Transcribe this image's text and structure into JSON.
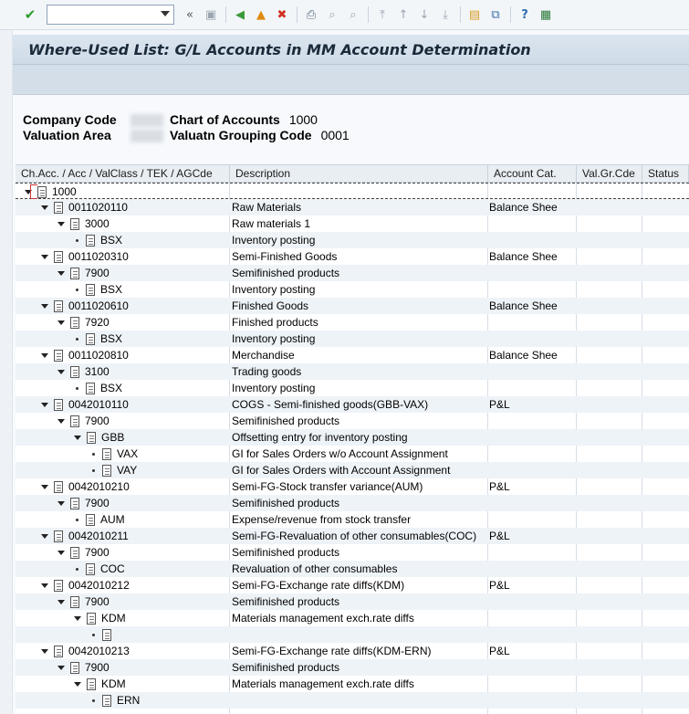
{
  "toolbar": {
    "icons": [
      "check-icon",
      "command-field",
      "back-arrows-icon",
      "save-icon",
      "back-icon",
      "exit-icon",
      "cancel-icon",
      "print-icon",
      "find-icon",
      "find-next-icon",
      "first-page-icon",
      "prev-page-icon",
      "next-page-icon",
      "last-page-icon",
      "create-session-icon",
      "shortcut-icon",
      "help-icon",
      "customize-icon"
    ]
  },
  "title": "Where-Used List: G/L Accounts in MM Account Determination",
  "header": {
    "company_code_label": "Company Code",
    "valuation_area_label": "Valuation Area",
    "chart_of_accounts_label": "Chart of Accounts",
    "chart_of_accounts_value": "1000",
    "valuation_grouping_label": "Valuatn Grouping Code",
    "valuation_grouping_value": "0001"
  },
  "columns": [
    "Ch.Acc. / Acc / ValClass / TEK  / AGCde",
    "Description",
    "Account Cat.",
    "Val.Gr.Cde",
    "Status"
  ],
  "rows": [
    {
      "level": 0,
      "node": "1000",
      "desc": "",
      "cat": "",
      "expanded": true
    },
    {
      "level": 1,
      "node": "0011020110",
      "desc": "Raw Materials",
      "cat": "Balance Shee",
      "expanded": true
    },
    {
      "level": 2,
      "node": "3000",
      "desc": "Raw materials 1",
      "cat": "",
      "expanded": true
    },
    {
      "level": 3,
      "node": "BSX",
      "desc": "Inventory posting",
      "cat": "",
      "leaf": true
    },
    {
      "level": 1,
      "node": "0011020310",
      "desc": "Semi-Finished Goods",
      "cat": "Balance Shee",
      "expanded": true
    },
    {
      "level": 2,
      "node": "7900",
      "desc": "Semifinished products",
      "cat": "",
      "expanded": true
    },
    {
      "level": 3,
      "node": "BSX",
      "desc": "Inventory posting",
      "cat": "",
      "leaf": true
    },
    {
      "level": 1,
      "node": "0011020610",
      "desc": "Finished Goods",
      "cat": "Balance Shee",
      "expanded": true
    },
    {
      "level": 2,
      "node": "7920",
      "desc": "Finished products",
      "cat": "",
      "expanded": true
    },
    {
      "level": 3,
      "node": "BSX",
      "desc": "Inventory posting",
      "cat": "",
      "leaf": true
    },
    {
      "level": 1,
      "node": "0011020810",
      "desc": "Merchandise",
      "cat": "Balance Shee",
      "expanded": true
    },
    {
      "level": 2,
      "node": "3100",
      "desc": "Trading goods",
      "cat": "",
      "expanded": true
    },
    {
      "level": 3,
      "node": "BSX",
      "desc": "Inventory posting",
      "cat": "",
      "leaf": true
    },
    {
      "level": 1,
      "node": "0042010110",
      "desc": "COGS - Semi-finished goods(GBB-VAX)",
      "cat": "P&L",
      "expanded": true
    },
    {
      "level": 2,
      "node": "7900",
      "desc": "Semifinished products",
      "cat": "",
      "expanded": true
    },
    {
      "level": 3,
      "node": "GBB",
      "desc": "Offsetting entry for inventory posting",
      "cat": "",
      "expanded": true
    },
    {
      "level": 4,
      "node": "VAX",
      "desc": "GI for Sales Orders w/o Account Assignment",
      "cat": "",
      "leaf": true
    },
    {
      "level": 4,
      "node": "VAY",
      "desc": "GI for Sales Orders with Account Assignment",
      "cat": "",
      "leaf": true
    },
    {
      "level": 1,
      "node": "0042010210",
      "desc": "Semi-FG-Stock transfer variance(AUM)",
      "cat": "P&L",
      "expanded": true
    },
    {
      "level": 2,
      "node": "7900",
      "desc": "Semifinished products",
      "cat": "",
      "expanded": true
    },
    {
      "level": 3,
      "node": "AUM",
      "desc": "Expense/revenue from stock transfer",
      "cat": "",
      "leaf": true
    },
    {
      "level": 1,
      "node": "0042010211",
      "desc": "Semi-FG-Revaluation of other consumables(COC)",
      "cat": "P&L",
      "expanded": true
    },
    {
      "level": 2,
      "node": "7900",
      "desc": "Semifinished products",
      "cat": "",
      "expanded": true
    },
    {
      "level": 3,
      "node": "COC",
      "desc": "Revaluation of other consumables",
      "cat": "",
      "leaf": true
    },
    {
      "level": 1,
      "node": "0042010212",
      "desc": "Semi-FG-Exchange rate diffs(KDM)",
      "cat": "P&L",
      "expanded": true
    },
    {
      "level": 2,
      "node": "7900",
      "desc": "Semifinished products",
      "cat": "",
      "expanded": true
    },
    {
      "level": 3,
      "node": "KDM",
      "desc": "Materials management exch.rate diffs",
      "cat": "",
      "expanded": true
    },
    {
      "level": 4,
      "node": "",
      "desc": "",
      "cat": "",
      "leaf": true
    },
    {
      "level": 1,
      "node": "0042010213",
      "desc": "Semi-FG-Exchange rate diffs(KDM-ERN)",
      "cat": "P&L",
      "expanded": true
    },
    {
      "level": 2,
      "node": "7900",
      "desc": "Semifinished products",
      "cat": "",
      "expanded": true
    },
    {
      "level": 3,
      "node": "KDM",
      "desc": "Materials management exch.rate diffs",
      "cat": "",
      "expanded": true
    },
    {
      "level": 4,
      "node": "ERN",
      "desc": "",
      "cat": "",
      "leaf": true
    }
  ]
}
